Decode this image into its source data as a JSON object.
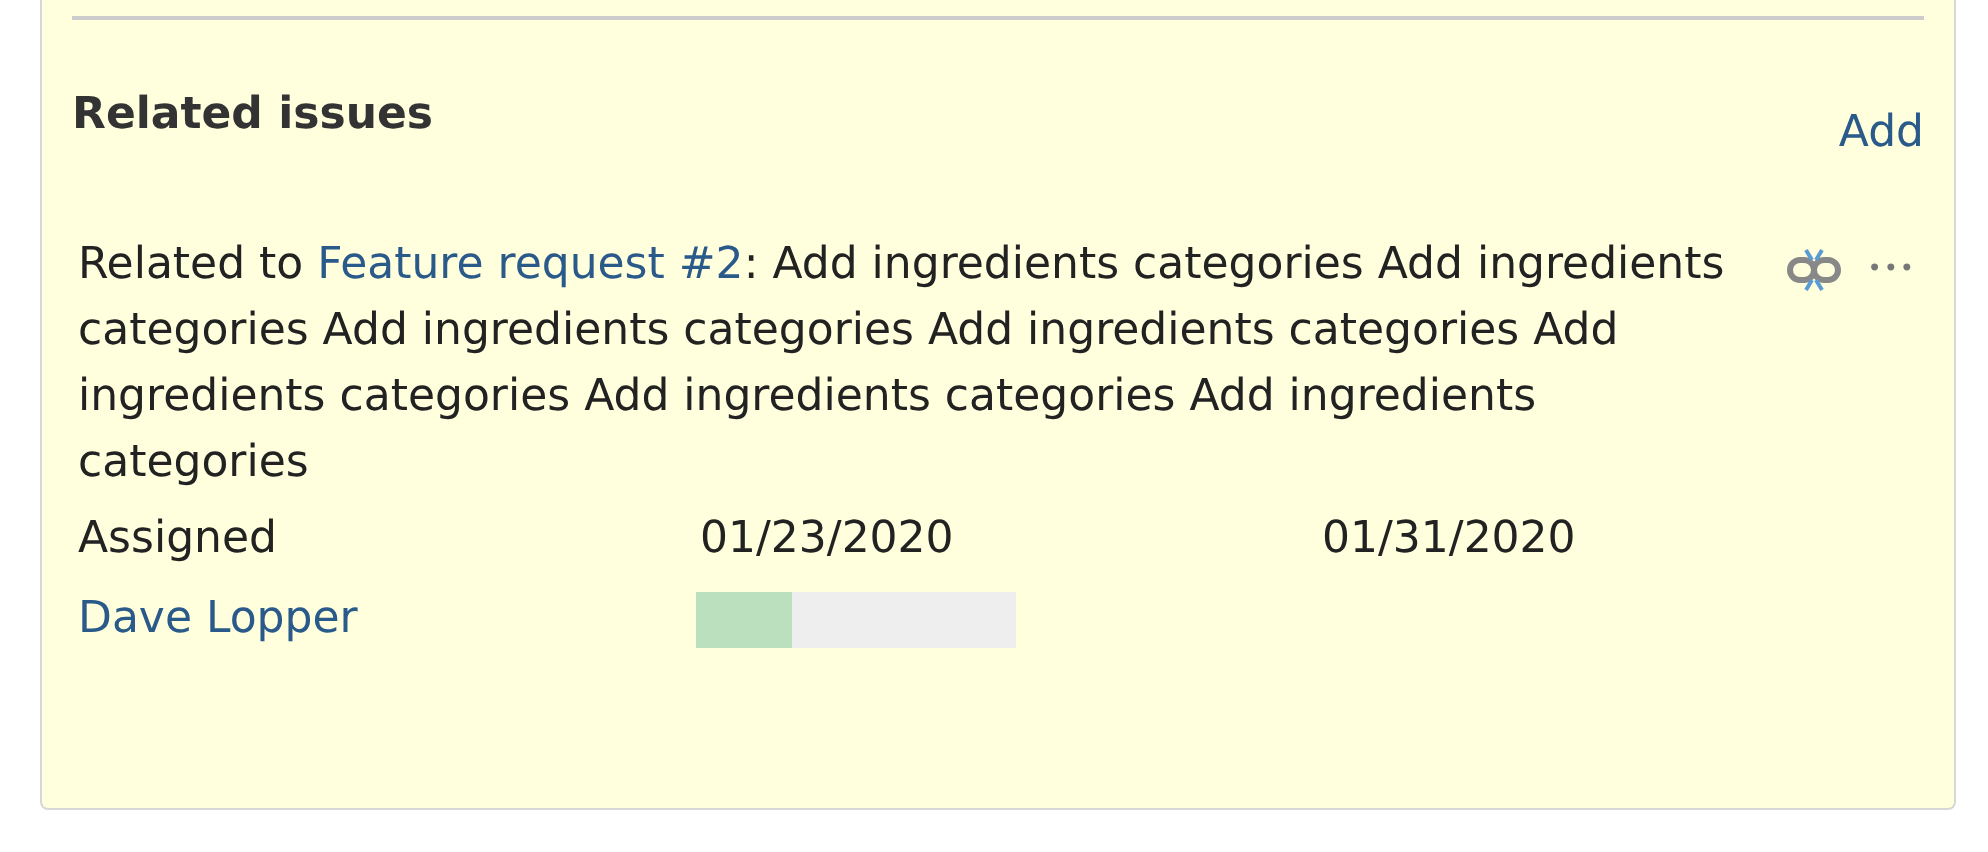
{
  "section": {
    "title": "Related issues",
    "add_link": "Add"
  },
  "issues": [
    {
      "relation": "Related to ",
      "link": "Feature request #2",
      "subject": ": Add ingredients categories Add ingredients categories Add ingredients categories Add ingredients categories Add ingredients categories Add ingredients categories Add ingredients categories",
      "status": "Assigned",
      "start_date": "01/23/2020",
      "due_date": "01/31/2020",
      "assignee": "Dave Lopper",
      "level": 0.3,
      "menu": "•••"
    }
  ]
}
